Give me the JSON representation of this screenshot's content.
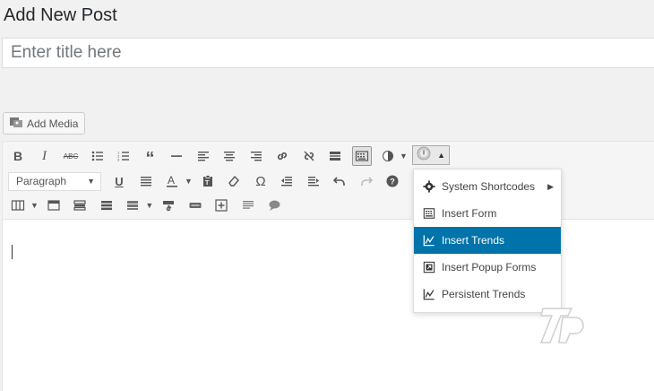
{
  "page": {
    "title": "Add New Post"
  },
  "title_field": {
    "placeholder": "Enter title here",
    "value": ""
  },
  "media": {
    "add_media_label": "Add Media"
  },
  "toolbar": {
    "format_select": "Paragraph"
  },
  "shortcode_menu": {
    "items": [
      {
        "label": "System Shortcodes",
        "icon": "gear-icon",
        "has_submenu": true
      },
      {
        "label": "Insert Form",
        "icon": "form-icon"
      },
      {
        "label": "Insert Trends",
        "icon": "trends-icon",
        "selected": true
      },
      {
        "label": "Insert Popup Forms",
        "icon": "popup-icon"
      },
      {
        "label": "Persistent Trends",
        "icon": "trends-icon"
      }
    ]
  },
  "colors": {
    "selected_bg": "#0073aa",
    "toolbar_bg": "#f5f5f5",
    "page_bg": "#f1f1f1"
  }
}
